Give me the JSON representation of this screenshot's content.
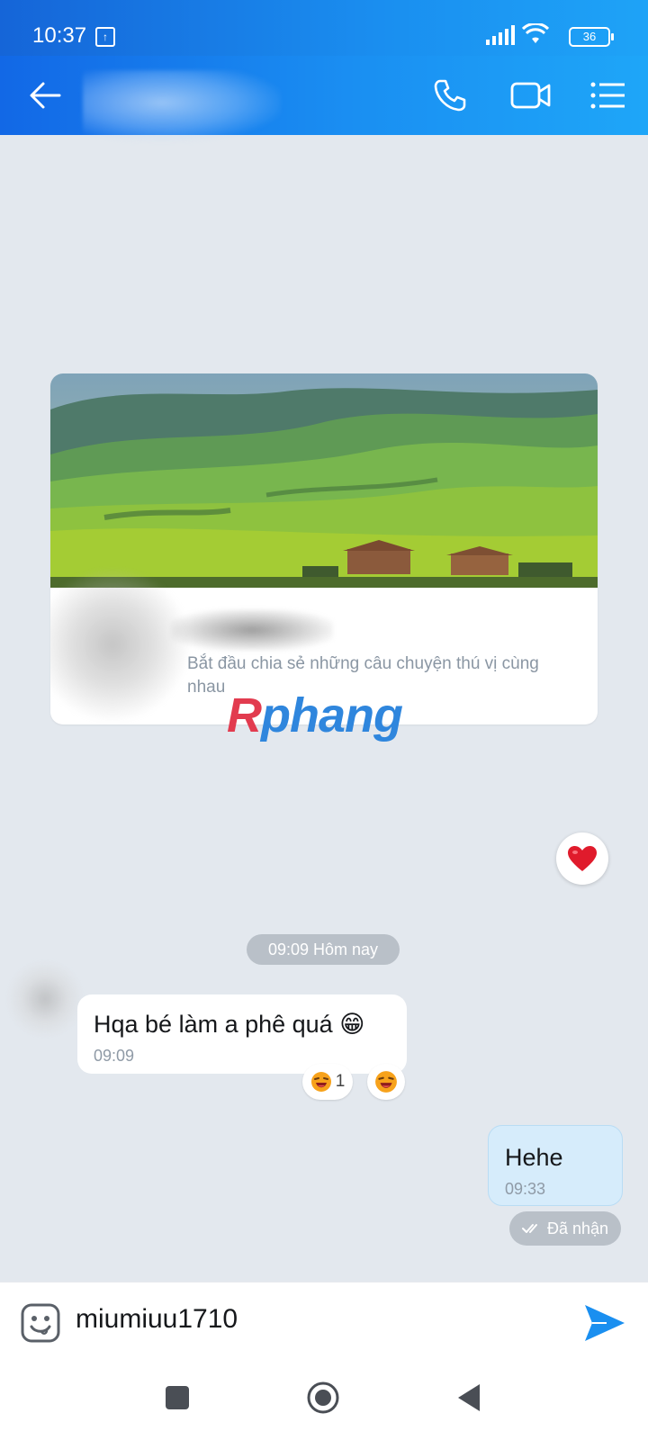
{
  "status_bar": {
    "time": "10:37",
    "battery": "36"
  },
  "header": {
    "back_icon": "arrow-left-icon",
    "call_icon": "phone-icon",
    "video_icon": "video-camera-icon",
    "menu_icon": "list-menu-icon"
  },
  "card": {
    "description": "Bắt đầu chia sẻ những câu chuyện thú vị cùng nhau"
  },
  "watermark": {
    "first": "R",
    "rest": "phang"
  },
  "messages": [
    {
      "direction": "incoming",
      "text": "Hqa bé làm a phê quá 😁",
      "time": "09:09",
      "reactions": [
        {
          "emoji": "laughing-face",
          "count": "1"
        },
        {
          "emoji": "laughing-face",
          "count": ""
        }
      ]
    },
    {
      "direction": "outgoing",
      "text": "Hehe",
      "time": "09:33",
      "status": "Đã nhận"
    }
  ],
  "date_separator": "09:09 Hôm nay",
  "composer": {
    "text": "miumiuu1710"
  },
  "colors": {
    "header_start": "#1268e6",
    "header_end": "#1ea6f8",
    "outgoing_bubble": "#d6ecfb",
    "send_button": "#1a8ff0"
  }
}
